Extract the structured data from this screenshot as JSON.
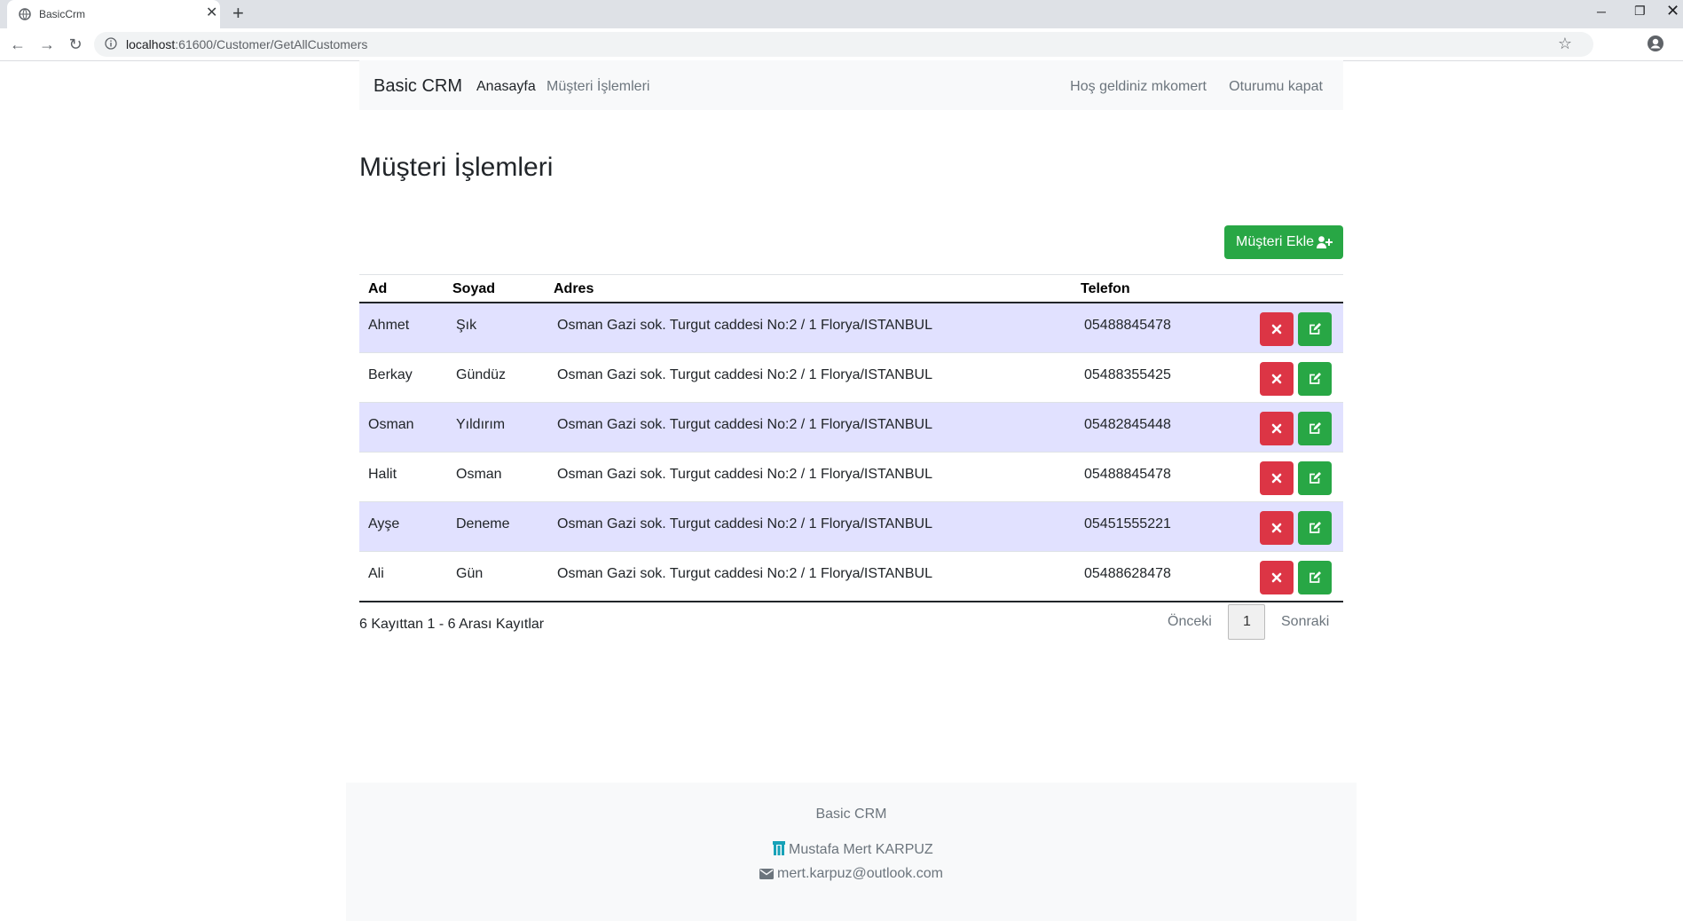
{
  "browser": {
    "tab_title": "BasicCrm",
    "url_host": "localhost",
    "url_rest": ":61600/Customer/GetAllCustomers"
  },
  "navbar": {
    "brand": "Basic CRM",
    "home": "Anasayfa",
    "customers": "Müşteri İşlemleri",
    "welcome": "Hoş geldiniz mkomert",
    "logout": "Oturumu kapat"
  },
  "page": {
    "title": "Müşteri İşlemleri",
    "add_button": "Müşteri Ekle"
  },
  "table": {
    "headers": {
      "first_name": "Ad",
      "last_name": "Soyad",
      "address": "Adres",
      "phone": "Telefon"
    },
    "rows": [
      {
        "first_name": "Ahmet",
        "last_name": "Şık",
        "address": "Osman Gazi sok. Turgut caddesi No:2 / 1 Florya/ISTANBUL",
        "phone": "05488845478"
      },
      {
        "first_name": "Berkay",
        "last_name": "Gündüz",
        "address": "Osman Gazi sok. Turgut caddesi No:2 / 1 Florya/ISTANBUL",
        "phone": "05488355425"
      },
      {
        "first_name": "Osman",
        "last_name": "Yıldırım",
        "address": "Osman Gazi sok. Turgut caddesi No:2 / 1 Florya/ISTANBUL",
        "phone": "05482845448"
      },
      {
        "first_name": "Halit",
        "last_name": "Osman",
        "address": "Osman Gazi sok. Turgut caddesi No:2 / 1 Florya/ISTANBUL",
        "phone": "05488845478"
      },
      {
        "first_name": "Ayşe",
        "last_name": "Deneme",
        "address": "Osman Gazi sok. Turgut caddesi No:2 / 1 Florya/ISTANBUL",
        "phone": "05451555221"
      },
      {
        "first_name": "Ali",
        "last_name": "Gün",
        "address": "Osman Gazi sok. Turgut caddesi No:2 / 1 Florya/ISTANBUL",
        "phone": "05488628478"
      }
    ]
  },
  "pagination": {
    "summary": "6 Kayıttan 1 - 6 Arası Kayıtlar",
    "prev": "Önceki",
    "current": "1",
    "next": "Sonraki"
  },
  "footer": {
    "title": "Basic CRM",
    "author": "Mustafa Mert KARPUZ",
    "email": "mert.karpuz@outlook.com"
  },
  "colors": {
    "success": "#28a745",
    "danger": "#dc3545",
    "row_highlight": "#e1e1ff",
    "navbar_bg": "#f8f9fa"
  },
  "icons": {
    "add_button": "user-plus-icon",
    "delete": "close-icon",
    "edit": "edit-icon",
    "author": "building-icon",
    "email": "envelope-icon"
  }
}
